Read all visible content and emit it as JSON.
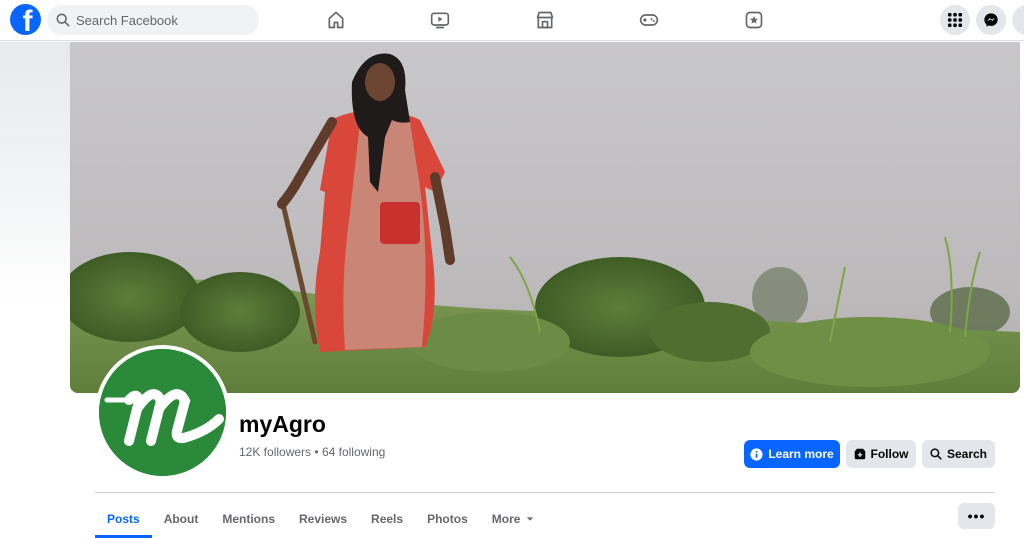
{
  "topbar": {
    "search_placeholder": "Search Facebook",
    "nav_icons": [
      "home-icon",
      "watch-icon",
      "marketplace-icon",
      "gaming-icon",
      "pages-icon"
    ],
    "right_icons": [
      "menu-grid-icon",
      "messenger-icon"
    ]
  },
  "page": {
    "name": "myAgro",
    "followers": "12K followers",
    "separator": "•",
    "following": "64 following"
  },
  "actions": {
    "learn_more": "Learn more",
    "follow": "Follow",
    "search": "Search"
  },
  "tabs": [
    {
      "label": "Posts",
      "active": true
    },
    {
      "label": "About"
    },
    {
      "label": "Mentions"
    },
    {
      "label": "Reviews"
    },
    {
      "label": "Reels"
    },
    {
      "label": "Photos"
    },
    {
      "label": "More"
    }
  ],
  "more_options": "•••",
  "colors": {
    "brand": "#0866ff",
    "logo_green": "#2a8a3a"
  }
}
